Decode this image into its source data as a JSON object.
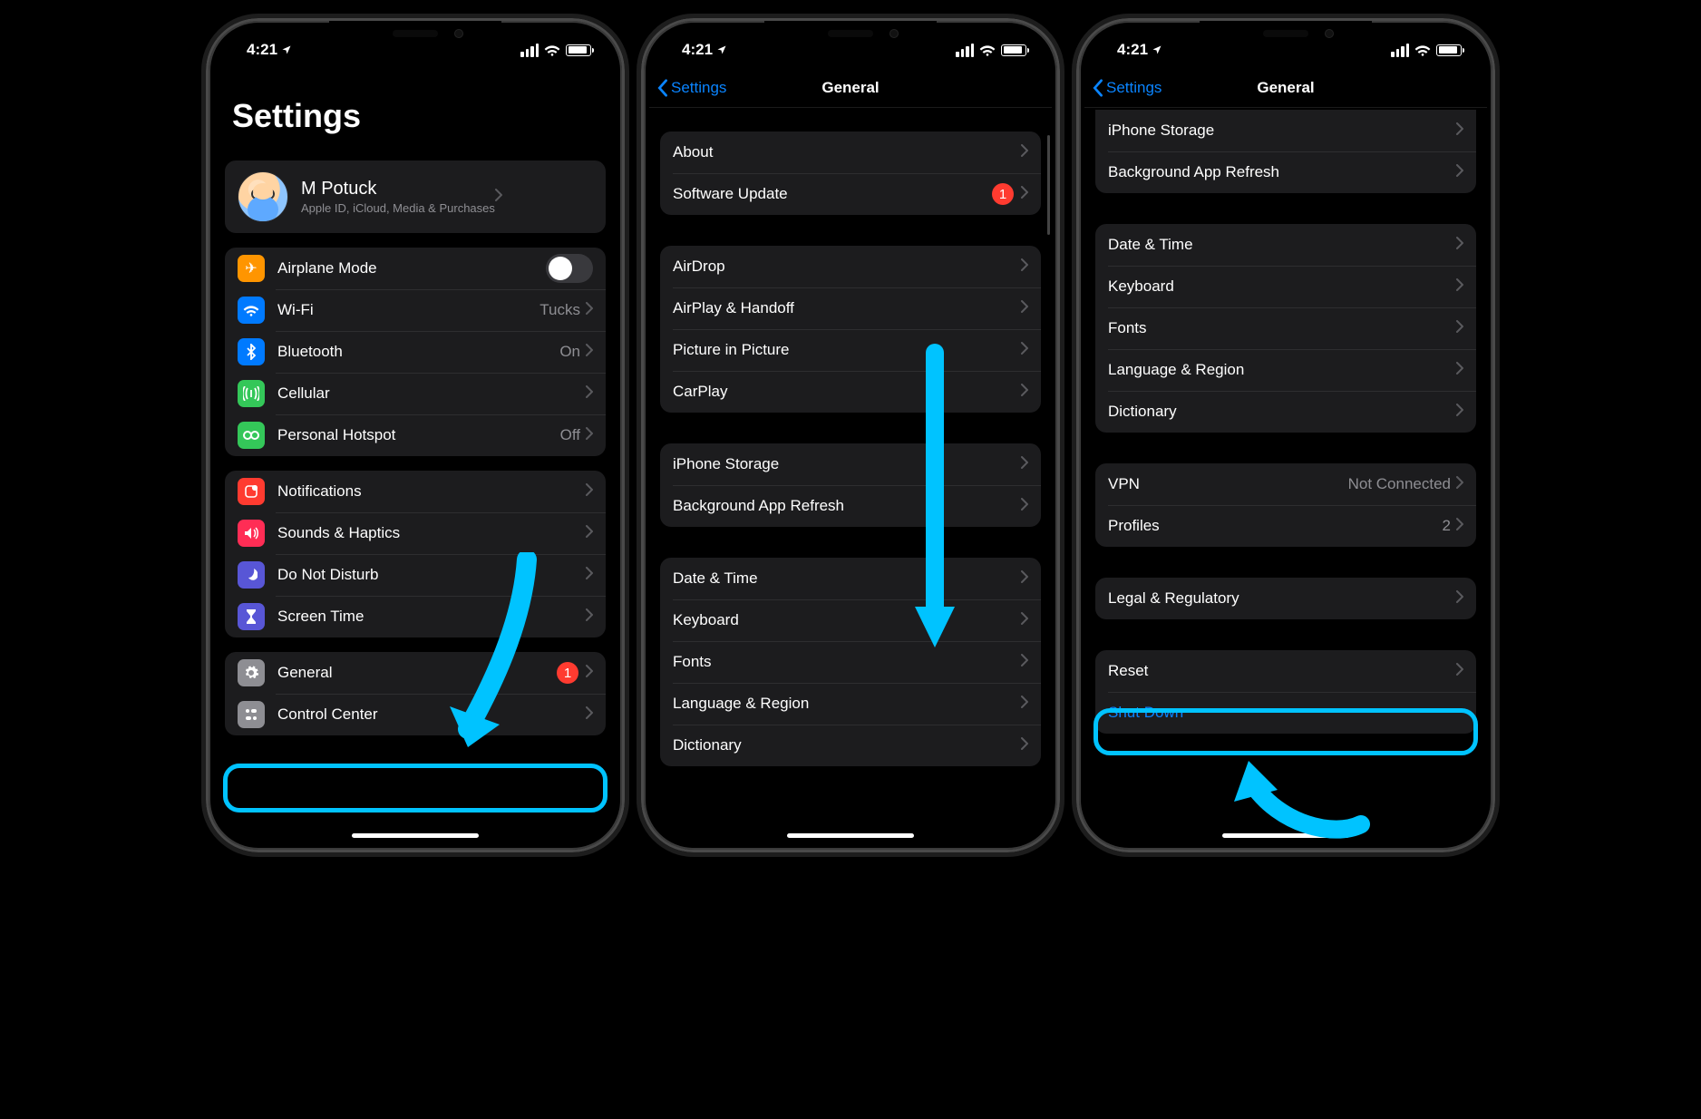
{
  "status": {
    "time": "4:21",
    "location_on": true
  },
  "colors": {
    "accent": "#0a84ff",
    "highlight": "#00c3ff",
    "badge": "#ff3b30",
    "group_bg": "#1c1c1e",
    "secondary_text": "#8e8e93"
  },
  "screen1": {
    "title": "Settings",
    "profile": {
      "name": "M Potuck",
      "subtitle": "Apple ID, iCloud, Media & Purchases"
    },
    "group_net": [
      {
        "icon": "airplane",
        "label": "Airplane Mode",
        "switch": false
      },
      {
        "icon": "wifi",
        "label": "Wi-Fi",
        "value": "Tucks"
      },
      {
        "icon": "bluetooth",
        "label": "Bluetooth",
        "value": "On"
      },
      {
        "icon": "cellular",
        "label": "Cellular"
      },
      {
        "icon": "hotspot",
        "label": "Personal Hotspot",
        "value": "Off"
      }
    ],
    "group_notify": [
      {
        "icon": "notifications",
        "label": "Notifications"
      },
      {
        "icon": "sounds",
        "label": "Sounds & Haptics"
      },
      {
        "icon": "dnd",
        "label": "Do Not Disturb"
      },
      {
        "icon": "screentime",
        "label": "Screen Time"
      }
    ],
    "group_general": [
      {
        "icon": "general",
        "label": "General",
        "badge": "1"
      },
      {
        "icon": "controlcenter",
        "label": "Control Center"
      }
    ]
  },
  "screen2": {
    "back": "Settings",
    "title": "General",
    "group_a": [
      {
        "label": "About"
      },
      {
        "label": "Software Update",
        "badge": "1"
      }
    ],
    "group_b": [
      {
        "label": "AirDrop"
      },
      {
        "label": "AirPlay & Handoff"
      },
      {
        "label": "Picture in Picture"
      },
      {
        "label": "CarPlay"
      }
    ],
    "group_c": [
      {
        "label": "iPhone Storage"
      },
      {
        "label": "Background App Refresh"
      }
    ],
    "group_d": [
      {
        "label": "Date & Time"
      },
      {
        "label": "Keyboard"
      },
      {
        "label": "Fonts"
      },
      {
        "label": "Language & Region"
      },
      {
        "label": "Dictionary"
      }
    ]
  },
  "screen3": {
    "back": "Settings",
    "title": "General",
    "group_c": [
      {
        "label": "iPhone Storage"
      },
      {
        "label": "Background App Refresh"
      }
    ],
    "group_d": [
      {
        "label": "Date & Time"
      },
      {
        "label": "Keyboard"
      },
      {
        "label": "Fonts"
      },
      {
        "label": "Language & Region"
      },
      {
        "label": "Dictionary"
      }
    ],
    "group_e": [
      {
        "label": "VPN",
        "value": "Not Connected"
      },
      {
        "label": "Profiles",
        "value": "2"
      }
    ],
    "group_f": [
      {
        "label": "Legal & Regulatory"
      }
    ],
    "group_g": [
      {
        "label": "Reset"
      },
      {
        "label": "Shut Down",
        "style": "link"
      }
    ]
  }
}
